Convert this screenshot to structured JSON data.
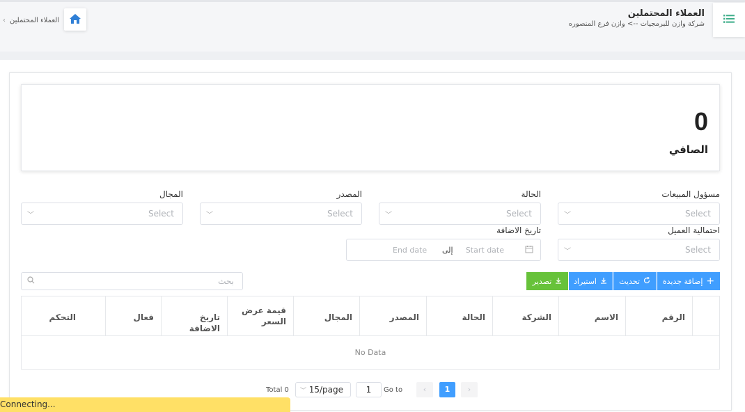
{
  "header": {
    "title": "العملاء المحتملين",
    "subtitle": "شركة وازن للبرمجيات --> وازن فرع المنصوره",
    "breadcrumb": "العملاء المحتملين",
    "menu_icon": "list-icon",
    "home_icon": "home-icon"
  },
  "stat": {
    "value": "0",
    "label": "الصافي"
  },
  "filters": {
    "sales_owner": {
      "label": "مسؤول المبيعات",
      "placeholder": "Select"
    },
    "status": {
      "label": "الحالة",
      "placeholder": "Select"
    },
    "source": {
      "label": "المصدر",
      "placeholder": "Select"
    },
    "field": {
      "label": "المجال",
      "placeholder": "Select"
    },
    "probability": {
      "label": "احتمالية العميل",
      "placeholder": "Select"
    },
    "added_date": {
      "label": "تاريخ الاضافة",
      "start": "Start date",
      "to": "إلى",
      "end": "End date"
    }
  },
  "toolbar": {
    "add": "إضافة جديدة",
    "refresh": "تحديث",
    "import": "استيراد",
    "export": "تصدير",
    "search_placeholder": "بحث"
  },
  "table": {
    "columns": [
      "الرقم",
      "الاسم",
      "الشركة",
      "الحالة",
      "المصدر",
      "المجال",
      "قيمة عرض السعر",
      "تاريخ الاضافة",
      "فعال",
      "التحكم"
    ],
    "empty": "No Data"
  },
  "pagination": {
    "total": "Total 0",
    "page_size": "15/page",
    "goto_label": "Go to",
    "goto_value": "1",
    "current_page": "1"
  },
  "status_bar": "Connecting...",
  "colors": {
    "primary": "#409eff",
    "success": "#67c23a",
    "accent_icon": "#3fae8a",
    "status_bar": "#ffe066"
  }
}
